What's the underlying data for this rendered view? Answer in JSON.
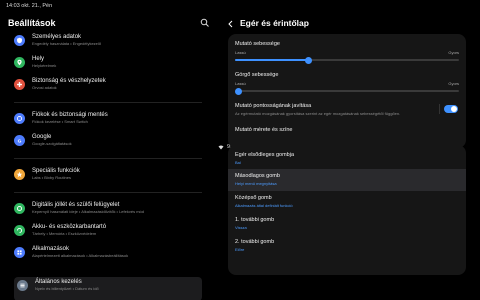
{
  "status": {
    "time": "14:03",
    "date": "okt. 21., Pén",
    "battery": "95%"
  },
  "colors": {
    "accent": "#3e91ff",
    "background": "#000000",
    "card": "#161616"
  },
  "left": {
    "title": "Beállítások",
    "items": [
      {
        "title": "Személyes adatok",
        "sub": "Engedély használata • Engedélykezelő",
        "icon": "shield-icon",
        "color": "#4d7cfe"
      },
      {
        "title": "Hely",
        "sub": "Helykérelmek",
        "icon": "location-pin-icon",
        "color": "#2fb65f"
      },
      {
        "title": "Biztonság és vészhelyzetek",
        "sub": "Orvosi adatok",
        "icon": "emergency-icon",
        "color": "#e0513e"
      },
      {
        "title": "Fiókok és biztonsági mentés",
        "sub": "Fiókok kezelése • Smart Switch",
        "icon": "sync-icon",
        "color": "#4d7cfe"
      },
      {
        "title": "Google",
        "sub": "Google-szolgáltatások",
        "icon": "google-icon",
        "color": "#4d7cfe"
      },
      {
        "title": "Speciális funkciók",
        "sub": "Labs • Bixby Routines",
        "icon": "star-icon",
        "color": "#f0a63a"
      },
      {
        "title": "Digitális jóllét és szülői felügyelet",
        "sub": "Kepernyő használati ideje • Alkalmazásidőzítők • Lefekvés mód",
        "icon": "wellbeing-icon",
        "color": "#2fb65f"
      },
      {
        "title": "Akku- és eszközkarbantartó",
        "sub": "Tárhely • Memória • Eszközvédelem",
        "icon": "battery-care-icon",
        "color": "#2fb65f"
      },
      {
        "title": "Alkalmazások",
        "sub": "Alapértelmezett alkalmazások • Alkalmazásbeállítások",
        "icon": "apps-icon",
        "color": "#4d7cfe"
      },
      {
        "title": "Általános kezelés",
        "sub": "Nyelv és billentyűzet • Dátum és idő",
        "icon": "general-management-icon",
        "color": "#6b7a8c"
      }
    ]
  },
  "right": {
    "title": "Egér és érintőlap",
    "pointer_speed": {
      "label": "Mutató sebessége",
      "min": "Lassú",
      "max": "Gyors",
      "value": 0.33
    },
    "scroll_speed": {
      "label": "Görgő sebessége",
      "min": "Lassú",
      "max": "Gyors",
      "value": 0.0
    },
    "precision": {
      "label": "Mutató pontosságának javítása",
      "sub": "Az egérmutató mozgásának gyorsítása szerint az egér mozgatásának sebességétől függően.",
      "on": true
    },
    "pointer_size": {
      "label": "Mutató mérete és színe"
    },
    "buttons": [
      {
        "label": "Egér elsődleges gombja",
        "value": "Bal"
      },
      {
        "label": "Másodlagos gomb",
        "value": "Helyi menü megnyitása"
      },
      {
        "label": "Középső gomb",
        "value": "Alkalmazás által definiált funkció"
      },
      {
        "label": "1. további gomb",
        "value": "Vissza"
      },
      {
        "label": "2. további gomb",
        "value": "Előre"
      }
    ]
  }
}
